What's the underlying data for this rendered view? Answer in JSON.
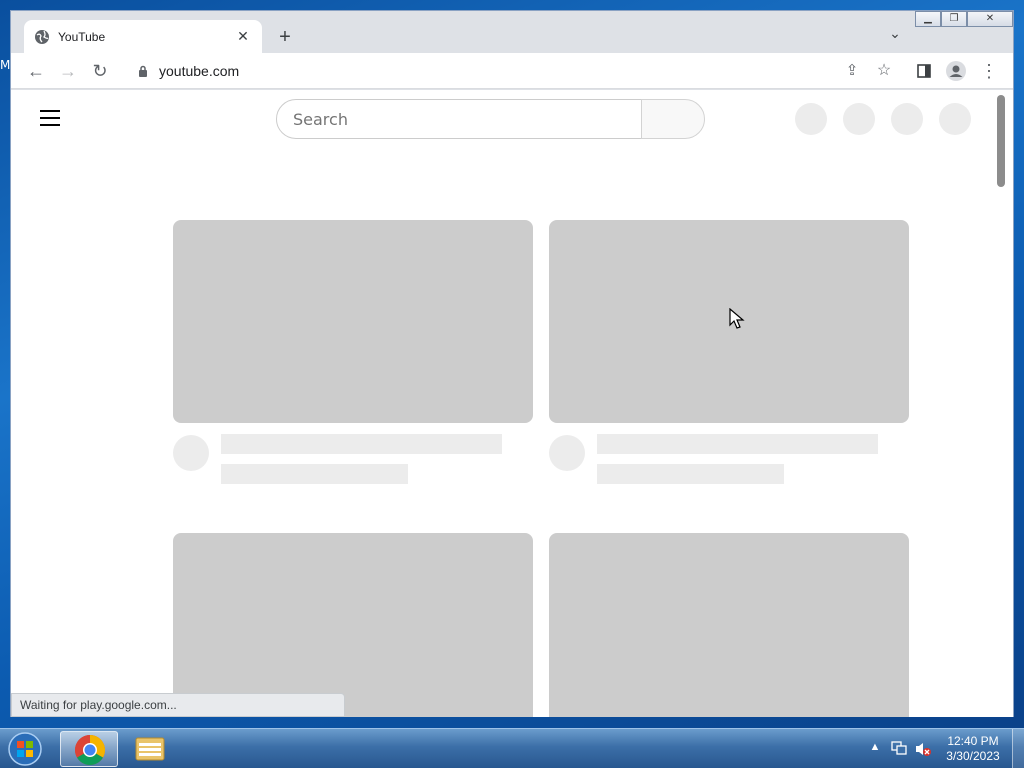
{
  "desktop": {
    "edge_letter": "M"
  },
  "browser": {
    "tab": {
      "title": "YouTube",
      "favicon": "globe-icon",
      "close_icon": "close-icon"
    },
    "new_tab_icon": "plus-icon",
    "tab_search_icon": "chevron-down-icon",
    "window_controls": [
      "minimize-icon",
      "restore-icon",
      "close-icon"
    ],
    "toolbar": {
      "back_icon": "arrow-left-icon",
      "forward_icon": "arrow-right-icon",
      "reload_icon": "reload-icon",
      "url": "youtube.com",
      "share_icon": "share-icon",
      "bookmark_icon": "star-icon",
      "side_panel_icon": "side-panel-icon",
      "profile_icon": "profile-icon",
      "menu_icon": "more-vert-icon"
    },
    "status": "Waiting for play.google.com..."
  },
  "youtube": {
    "menu_icon": "hamburger-icon",
    "search": {
      "placeholder": "Search",
      "value": ""
    },
    "search_button_icon": "search-icon",
    "header_placeholders": 4,
    "card_placeholders": 4
  },
  "colors": {
    "skeleton_thumb": "#cccccc",
    "skeleton_line": "#ececec",
    "tabstrip": "#dee1e6"
  },
  "taskbar": {
    "start_icon": "windows-start-icon",
    "pinned": [
      "chrome-icon",
      "file-explorer-icon"
    ],
    "tray_icons": [
      "show-hidden-icons-arrow",
      "network-icon",
      "volume-muted-icon"
    ],
    "clock": {
      "time": "12:40 PM",
      "date": "3/30/2023"
    }
  }
}
